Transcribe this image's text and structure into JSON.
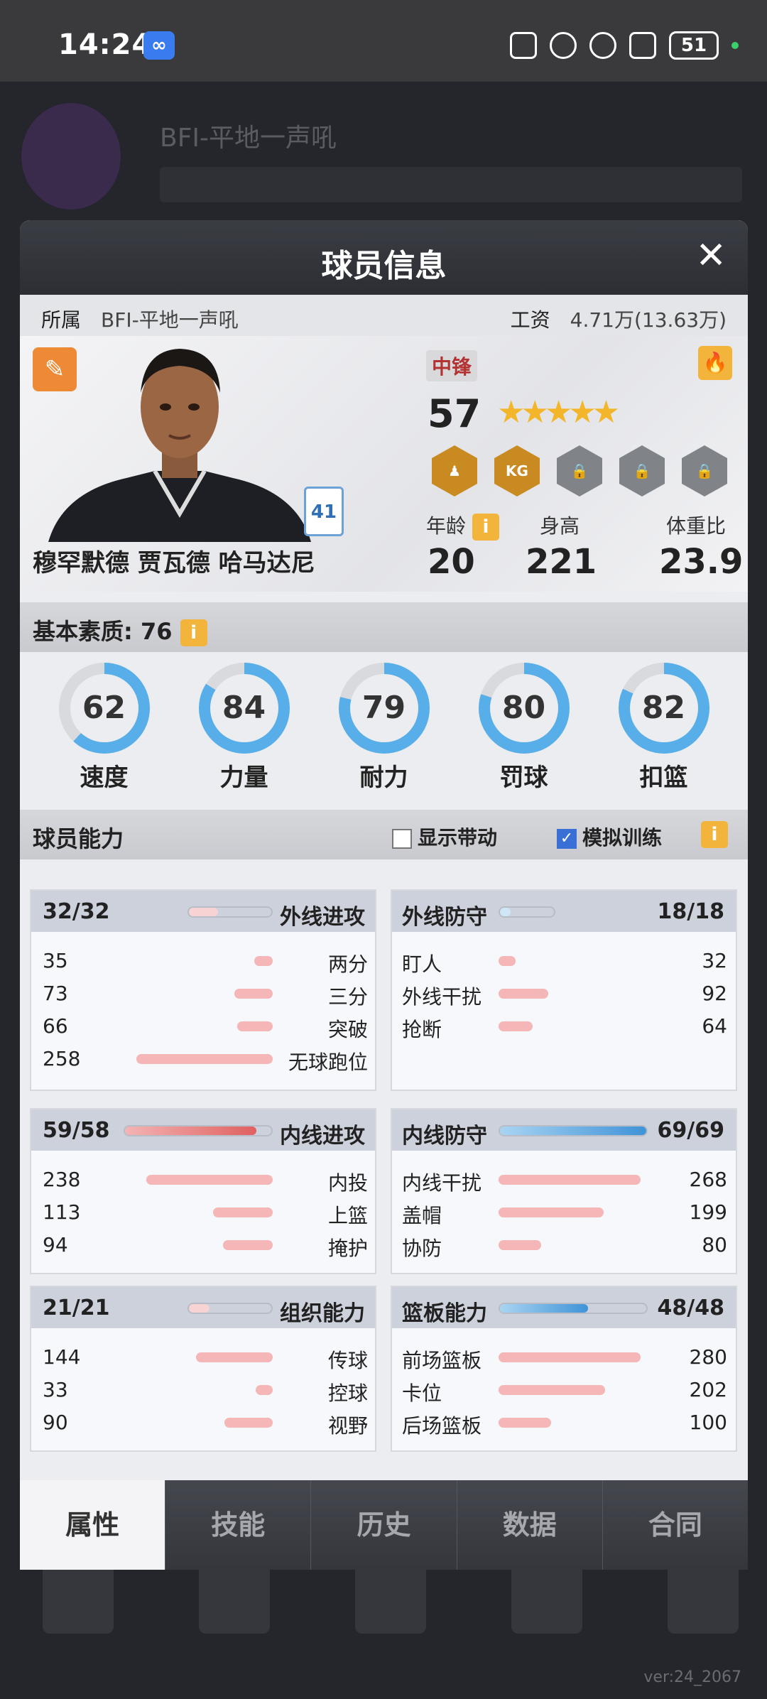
{
  "statusbar": {
    "time": "14:24",
    "battery": "51"
  },
  "background": {
    "team_name": "BFI-平地一声吼",
    "version": "ver:24_2067"
  },
  "modal": {
    "title": "球员信息",
    "team_label": "所属",
    "team_value": "BFI-平地一声吼",
    "salary_label": "工资",
    "salary_value": "4.71万(13.63万)",
    "player": {
      "name": "穆罕默德 贾瓦德 哈马达尼",
      "number": "41",
      "position": "中锋",
      "overall": "57",
      "stars": "★★★★★",
      "badges": [
        {
          "label": "",
          "icon": "player-icon"
        },
        {
          "label": "KG",
          "icon": "kg-icon"
        },
        {
          "label": "",
          "icon": "lock-icon"
        },
        {
          "label": "",
          "icon": "lock-icon"
        },
        {
          "label": "",
          "icon": "lock-icon"
        }
      ],
      "age_label": "年龄",
      "age": "20",
      "height_label": "身高",
      "height": "221",
      "ratio_label": "体重比",
      "ratio": "23.9"
    },
    "basic": {
      "label": "基本素质: 76",
      "items": [
        {
          "name": "速度",
          "value": "62",
          "pct": 62,
          "color": "#58aee8"
        },
        {
          "name": "力量",
          "value": "84",
          "pct": 84,
          "color": "#58aee8"
        },
        {
          "name": "耐力",
          "value": "79",
          "pct": 79,
          "color": "#58aee8"
        },
        {
          "name": "罚球",
          "value": "80",
          "pct": 80,
          "color": "#58aee8"
        },
        {
          "name": "扣篮",
          "value": "82",
          "pct": 82,
          "color": "#58aee8"
        }
      ]
    },
    "ability": {
      "label": "球员能力",
      "show_bonus": "显示带动",
      "simulate": "模拟训练"
    },
    "cards": {
      "outside_off": {
        "title": "外线进攻",
        "total": "32/32",
        "fill": 0.35,
        "rows": [
          {
            "name": "两分",
            "value": "35",
            "fill": 0.13
          },
          {
            "name": "三分",
            "value": "73",
            "fill": 0.27
          },
          {
            "name": "突破",
            "value": "66",
            "fill": 0.25
          },
          {
            "name": "无球跑位",
            "value": "258",
            "fill": 0.96
          }
        ]
      },
      "outside_def": {
        "title": "外线防守",
        "total": "18/18",
        "fill": 0.2,
        "rows": [
          {
            "name": "盯人",
            "value": "32",
            "fill": 0.12
          },
          {
            "name": "外线干扰",
            "value": "92",
            "fill": 0.35
          },
          {
            "name": "抢断",
            "value": "64",
            "fill": 0.24
          }
        ]
      },
      "inside_off": {
        "title": "内线进攻",
        "total": "59/58",
        "fill": 0.9,
        "rows": [
          {
            "name": "内投",
            "value": "238",
            "fill": 0.89
          },
          {
            "name": "上篮",
            "value": "113",
            "fill": 0.42
          },
          {
            "name": "掩护",
            "value": "94",
            "fill": 0.35
          }
        ]
      },
      "inside_def": {
        "title": "内线防守",
        "total": "69/69",
        "fill": 1.0,
        "rows": [
          {
            "name": "内线干扰",
            "value": "268",
            "fill": 1.0
          },
          {
            "name": "盖帽",
            "value": "199",
            "fill": 0.74
          },
          {
            "name": "协防",
            "value": "80",
            "fill": 0.3
          }
        ]
      },
      "playmake": {
        "title": "组织能力",
        "total": "21/21",
        "fill": 0.25,
        "rows": [
          {
            "name": "传球",
            "value": "144",
            "fill": 0.54
          },
          {
            "name": "控球",
            "value": "33",
            "fill": 0.12
          },
          {
            "name": "视野",
            "value": "90",
            "fill": 0.34
          }
        ]
      },
      "rebound": {
        "title": "篮板能力",
        "total": "48/48",
        "fill": 0.6,
        "rows": [
          {
            "name": "前场篮板",
            "value": "280",
            "fill": 1.0
          },
          {
            "name": "卡位",
            "value": "202",
            "fill": 0.75
          },
          {
            "name": "后场篮板",
            "value": "100",
            "fill": 0.37
          }
        ]
      }
    },
    "tabs": [
      "属性",
      "技能",
      "历史",
      "数据",
      "合同"
    ]
  }
}
